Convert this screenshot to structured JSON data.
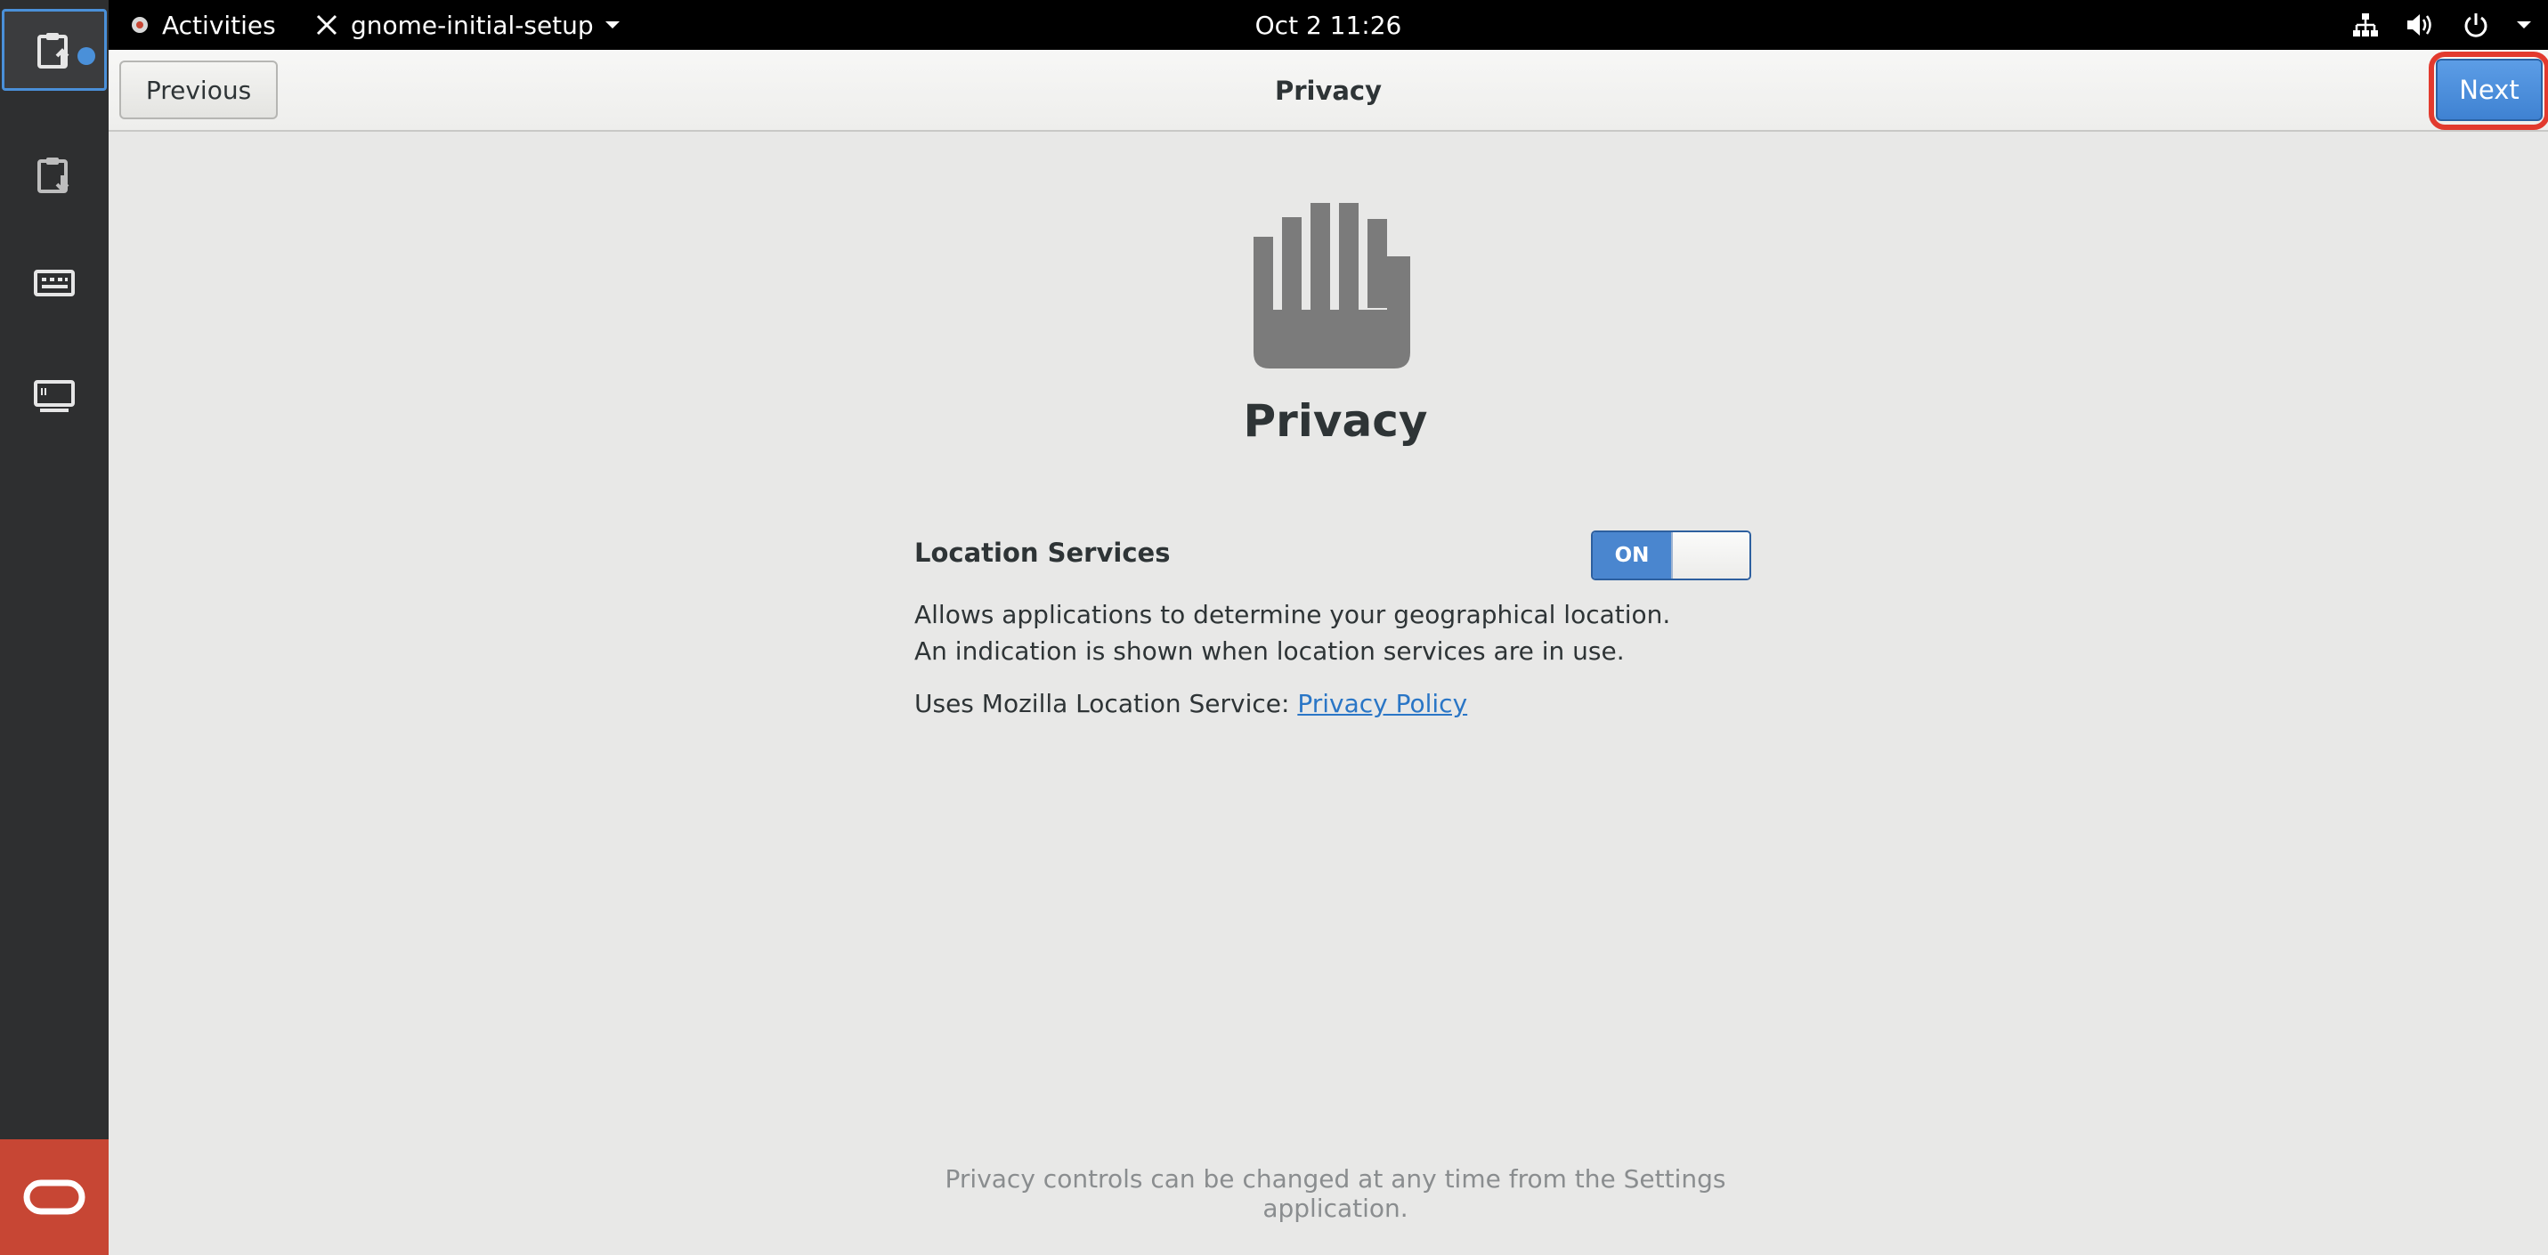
{
  "topbar": {
    "activities_label": "Activities",
    "app_name": "gnome-initial-setup",
    "clock": "Oct 2  11:26"
  },
  "dock": {
    "items": [
      "clipboard-upload-icon",
      "clipboard-download-icon",
      "keyboard-icon",
      "display-icon"
    ],
    "bottom_logo": "oracle-logo"
  },
  "headerbar": {
    "previous_label": "Previous",
    "title": "Privacy",
    "next_label": "Next"
  },
  "page": {
    "heading": "Privacy",
    "location_label": "Location Services",
    "switch_state": "ON",
    "description": "Allows applications to determine your geographical location. An indication is shown when location services are in use.",
    "policy_prefix": "Uses Mozilla Location Service: ",
    "policy_link": "Privacy Policy",
    "footer": "Privacy controls can be changed at any time from the Settings application."
  },
  "colors": {
    "accent": "#4a86cf",
    "highlight_ring": "#e23a2e",
    "dock_bg": "#2e2f30",
    "oracle_red": "#c74634"
  }
}
